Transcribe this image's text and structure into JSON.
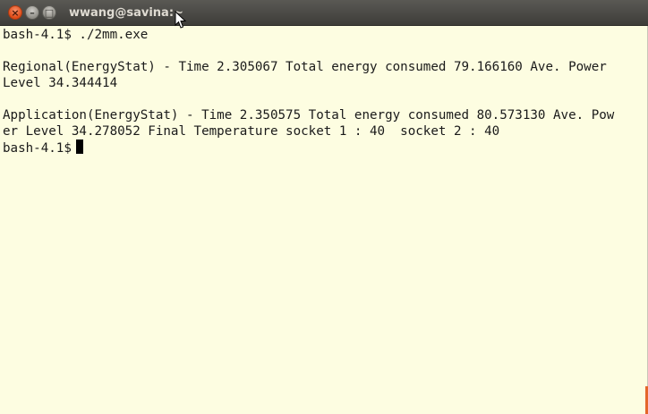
{
  "window": {
    "title": "wwang@savina:~",
    "close_glyph": "×",
    "min_glyph": "–",
    "max_glyph": "□"
  },
  "terminal": {
    "lines": [
      "bash-4.1$ ./2mm.exe",
      "",
      "Regional(EnergyStat) - Time 2.305067 Total energy consumed 79.166160 Ave. Power",
      "Level 34.344414",
      "",
      "Application(EnergyStat) - Time 2.350575 Total energy consumed 80.573130 Ave. Pow",
      "er Level 34.278052 Final Temperature socket 1 : 40  socket 2 : 40"
    ],
    "prompt": "bash-4.1$"
  },
  "colors": {
    "background": "#fdfde1",
    "titlebar": "#3e3d39",
    "close": "#df4a16",
    "accent": "#e4662b"
  }
}
